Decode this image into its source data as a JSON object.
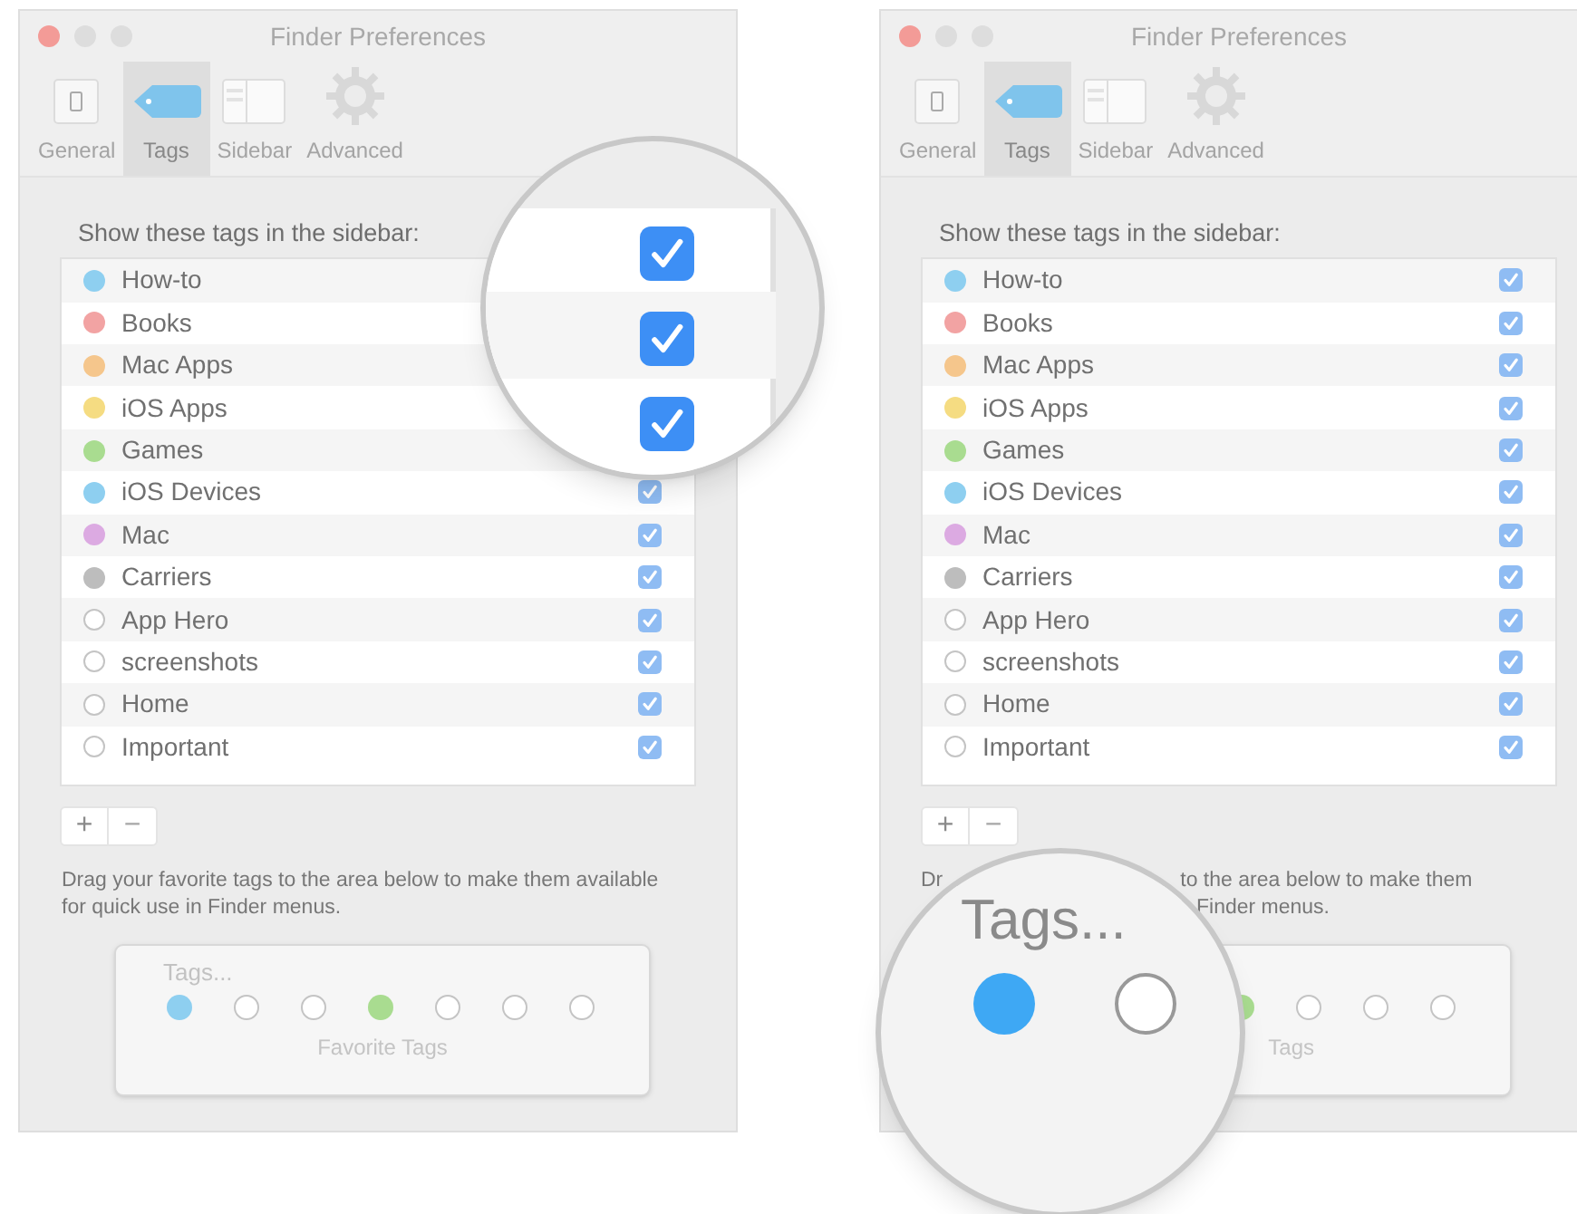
{
  "panels": [
    {
      "window": {
        "title": "Finder Preferences"
      },
      "tabs": [
        {
          "label": "General",
          "kind": "general",
          "selected": false
        },
        {
          "label": "Tags",
          "kind": "tags",
          "selected": true
        },
        {
          "label": "Sidebar",
          "kind": "sidebar",
          "selected": false
        },
        {
          "label": "Advanced",
          "kind": "advanced",
          "selected": false
        }
      ],
      "list_heading": "Show these tags in the sidebar:",
      "tags": [
        {
          "name": "How-to",
          "color": "#8ecff0"
        },
        {
          "name": "Books",
          "color": "#f2a3a3"
        },
        {
          "name": "Mac Apps",
          "color": "#f5c68c"
        },
        {
          "name": "iOS Apps",
          "color": "#f5dc82"
        },
        {
          "name": "Games",
          "color": "#a9dc90"
        },
        {
          "name": "iOS Devices",
          "color": "#8ecff0",
          "checked": true
        },
        {
          "name": "Mac",
          "color": "#dcaae2",
          "checked": true
        },
        {
          "name": "Carriers",
          "color": "#bdbdbd",
          "checked": true
        },
        {
          "name": "App Hero",
          "checked": true
        },
        {
          "name": "screenshots",
          "checked": true
        },
        {
          "name": "Home",
          "checked": true
        },
        {
          "name": "Important",
          "checked": true
        }
      ],
      "add_button": "+",
      "remove_button": "−",
      "description": "Drag your favorite tags to the area below to make them available for quick use in Finder menus.",
      "favorites": {
        "placeholder": "Tags...",
        "label": "Favorite Tags",
        "slots": [
          {
            "kind": "filled",
            "color": "#8ecff0"
          },
          {
            "kind": "empty"
          },
          {
            "kind": "empty"
          },
          {
            "kind": "filled",
            "color": "#a9dc90"
          },
          {
            "kind": "empty"
          },
          {
            "kind": "empty"
          },
          {
            "kind": "empty"
          }
        ]
      }
    },
    {
      "window": {
        "title": "Finder Preferences"
      },
      "tabs": [
        {
          "label": "General",
          "kind": "general",
          "selected": false
        },
        {
          "label": "Tags",
          "kind": "tags",
          "selected": true
        },
        {
          "label": "Sidebar",
          "kind": "sidebar",
          "selected": false
        },
        {
          "label": "Advanced",
          "kind": "advanced",
          "selected": false
        }
      ],
      "list_heading": "Show these tags in the sidebar:",
      "tags": [
        {
          "name": "How-to",
          "color": "#8ecff0",
          "checked": true
        },
        {
          "name": "Books",
          "color": "#f2a3a3",
          "checked": true
        },
        {
          "name": "Mac Apps",
          "color": "#f5c68c",
          "checked": true
        },
        {
          "name": "iOS Apps",
          "color": "#f5dc82",
          "checked": true
        },
        {
          "name": "Games",
          "color": "#a9dc90",
          "checked": true
        },
        {
          "name": "iOS Devices",
          "color": "#8ecff0",
          "checked": true
        },
        {
          "name": "Mac",
          "color": "#dcaae2",
          "checked": true
        },
        {
          "name": "Carriers",
          "color": "#bdbdbd",
          "checked": true
        },
        {
          "name": "App Hero",
          "checked": true
        },
        {
          "name": "screenshots",
          "checked": true
        },
        {
          "name": "Home",
          "checked": true
        },
        {
          "name": "Important",
          "checked": true
        }
      ],
      "add_button": "+",
      "remove_button": "−",
      "description_fragments": [
        "Dr",
        "to the area below to make them",
        "Finder menus."
      ],
      "favorites": {
        "label": "Tags",
        "slots": [
          {
            "kind": "filled",
            "color": "#a9dc90"
          },
          {
            "kind": "empty"
          },
          {
            "kind": "empty"
          },
          {
            "kind": "empty"
          }
        ]
      }
    }
  ],
  "magnifiers": [
    {
      "kind": "checkboxes",
      "checkboxes": [
        {
          "checked": true
        },
        {
          "checked": true
        },
        {
          "checked": true
        }
      ]
    },
    {
      "kind": "favorites",
      "placeholder": "Tags...",
      "dots": [
        {
          "kind": "filled",
          "color": "#3ea8f4"
        },
        {
          "kind": "empty"
        }
      ]
    }
  ]
}
